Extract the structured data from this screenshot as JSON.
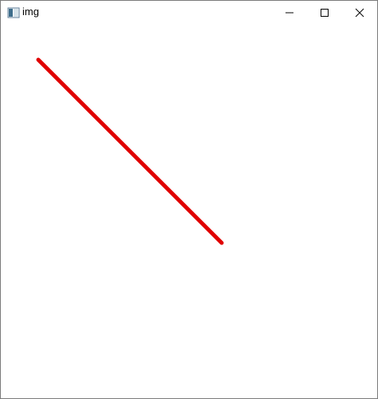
{
  "window": {
    "title": "img",
    "app_icon": "image-window-icon",
    "controls": {
      "minimize_icon": "minimize-icon",
      "maximize_icon": "maximize-icon",
      "close_icon": "close-icon"
    }
  },
  "canvas": {
    "background": "#ffffff",
    "line_color": "#e00000"
  }
}
